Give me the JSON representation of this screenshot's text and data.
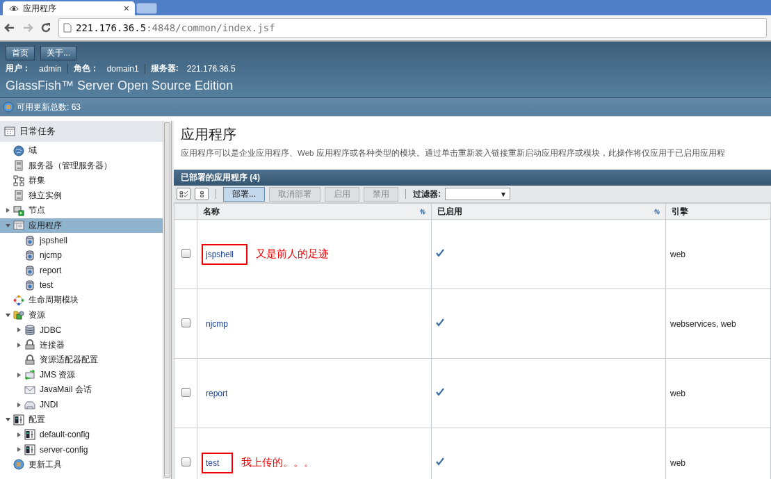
{
  "browser": {
    "tab_title": "应用程序",
    "tab_close": "×",
    "url_host": "221.176.36.5",
    "url_rest": ":4848/common/index.jsf"
  },
  "header": {
    "buttons": [
      "首页",
      "关于..."
    ],
    "user_info": [
      {
        "label": "用户：",
        "value": "admin"
      },
      {
        "label": "角色：",
        "value": "domain1"
      },
      {
        "label": "服务器:",
        "value": "221.176.36.5"
      }
    ],
    "product": "GlassFish™ Server Open Source Edition",
    "updates": "可用更新总数: 63"
  },
  "sidebar": {
    "title": "日常任务",
    "items": [
      {
        "label": "域",
        "kind": "leaf",
        "selected": false
      },
      {
        "label": "服务器（管理服务器）",
        "kind": "leaf",
        "selected": false
      },
      {
        "label": "群集",
        "kind": "leaf",
        "selected": false
      },
      {
        "label": "独立实例",
        "kind": "leaf",
        "selected": false
      },
      {
        "label": "节点",
        "kind": "folder",
        "expanded": false,
        "selected": false
      },
      {
        "label": "应用程序",
        "kind": "folder",
        "expanded": true,
        "selected": true,
        "children": [
          {
            "label": "jspshell",
            "kind": "leaf",
            "selected": false
          },
          {
            "label": "njcmp",
            "kind": "leaf",
            "selected": false
          },
          {
            "label": "report",
            "kind": "leaf",
            "selected": false
          },
          {
            "label": "test",
            "kind": "leaf",
            "selected": false
          }
        ]
      },
      {
        "label": "生命周期模块",
        "kind": "leaf",
        "selected": false
      },
      {
        "label": "资源",
        "kind": "folder",
        "expanded": true,
        "selected": false,
        "children": [
          {
            "label": "JDBC",
            "kind": "folder",
            "expanded": false,
            "selected": false
          },
          {
            "label": "连接器",
            "kind": "folder",
            "expanded": false,
            "selected": false
          },
          {
            "label": "资源适配器配置",
            "kind": "leaf",
            "selected": false
          },
          {
            "label": "JMS 资源",
            "kind": "folder",
            "expanded": false,
            "selected": false
          },
          {
            "label": "JavaMail 会话",
            "kind": "leaf",
            "selected": false
          },
          {
            "label": "JNDI",
            "kind": "folder",
            "expanded": false,
            "selected": false
          }
        ]
      },
      {
        "label": "配置",
        "kind": "folder",
        "expanded": true,
        "selected": false,
        "children": [
          {
            "label": "default-config",
            "kind": "folder",
            "expanded": false,
            "selected": false
          },
          {
            "label": "server-config",
            "kind": "folder",
            "expanded": false,
            "selected": false
          }
        ]
      },
      {
        "label": "更新工具",
        "kind": "leaf",
        "selected": false
      }
    ]
  },
  "main": {
    "title": "应用程序",
    "description": "应用程序可以是企业应用程序、Web 应用程序或各种类型的模块。通过单击重新装入链接重新启动应用程序或模块，此操作将仅应用于已启用应用程",
    "table": {
      "title": "已部署的应用程序 (4)",
      "actions": [
        {
          "label": "部署...",
          "disabled": false
        },
        {
          "label": "取消部署",
          "disabled": true
        },
        {
          "label": "启用",
          "disabled": true
        },
        {
          "label": "禁用",
          "disabled": true
        }
      ],
      "filter": {
        "label": "过滤器:",
        "arrow": "▼"
      },
      "columns": [
        {
          "label": "名称",
          "sortable": true
        },
        {
          "label": "已启用",
          "sortable": true
        },
        {
          "label": "引擎",
          "sortable": false
        }
      ],
      "rows": [
        {
          "checked": false,
          "name": "jspshell",
          "highlighted": true,
          "note": "又是前人的足迹",
          "enabled": true,
          "engines": "web"
        },
        {
          "checked": false,
          "name": "njcmp",
          "highlighted": false,
          "enabled": true,
          "engines": "webservices, web"
        },
        {
          "checked": false,
          "name": "report",
          "highlighted": false,
          "enabled": true,
          "engines": "web"
        },
        {
          "checked": false,
          "name": "test",
          "highlighted": true,
          "note": "我上传的。。。",
          "enabled": true,
          "engines": "web"
        }
      ]
    }
  }
}
